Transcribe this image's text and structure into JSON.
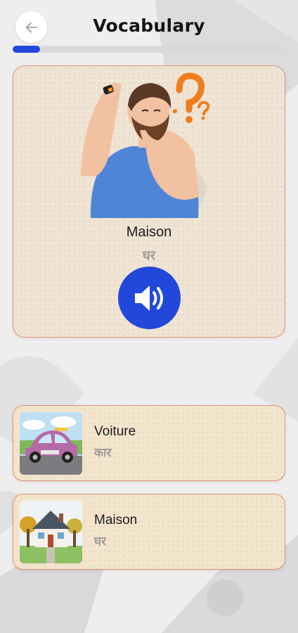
{
  "header": {
    "title": "Vocabulary",
    "back_icon": "arrow-left-icon"
  },
  "progress": {
    "fraction": 0.1
  },
  "main_card": {
    "illustration": "confused-man-question-marks",
    "word": "Maison",
    "translation": "घर",
    "speaker_icon": "speaker-volume-icon"
  },
  "list": [
    {
      "word": "Voiture",
      "translation": "कार",
      "image": "vintage-purple-car"
    },
    {
      "word": "Maison",
      "translation": "घर",
      "image": "house-with-trees"
    }
  ],
  "colors": {
    "accent": "#2248db",
    "card_border": "#e09178",
    "background": "#eeeeef"
  }
}
